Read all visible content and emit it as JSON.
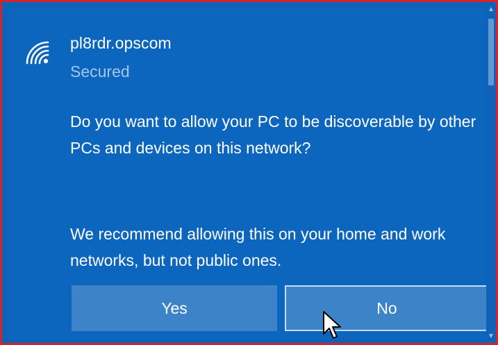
{
  "network": {
    "ssid": "pl8rdr.opscom",
    "status": "Secured",
    "icon": "wifi-signal-icon"
  },
  "prompt": {
    "question": "Do you want to allow your PC to be discoverable by other PCs and devices on this network?",
    "recommendation": "We recommend allowing this on your home and work networks, but not public ones."
  },
  "buttons": {
    "yes_label": "Yes",
    "no_label": "No"
  },
  "colors": {
    "panel_bg": "#0e63b8",
    "button_bg": "#3d83c8",
    "secondary_text": "#a6c6e6",
    "focus_border": "#c9dcef",
    "highlight_frame": "#d2252b"
  }
}
